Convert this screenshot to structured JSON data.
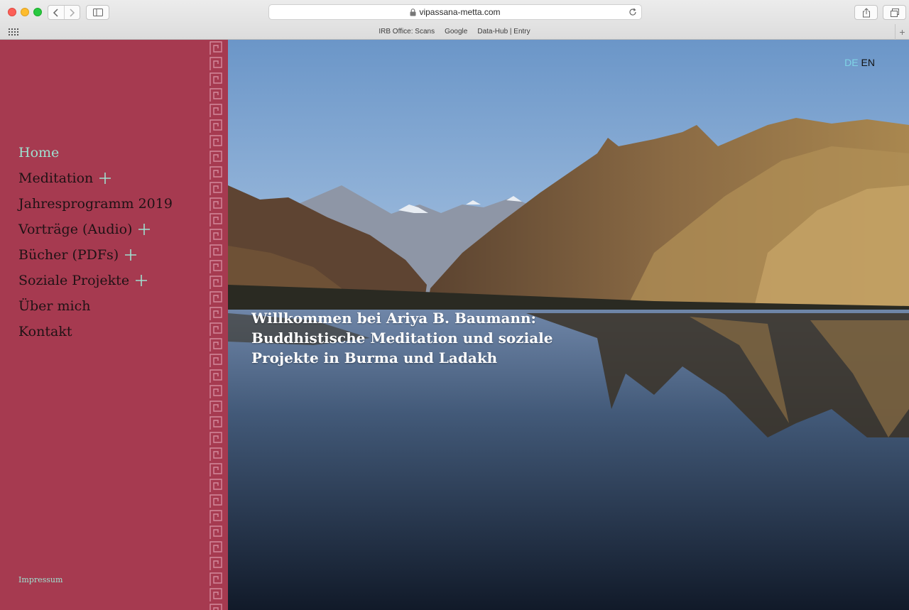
{
  "browser": {
    "url": "vipassana-metta.com",
    "bookmarks": [
      "IRB Office: Scans",
      "Google",
      "Data-Hub | Entry"
    ],
    "new_tab_symbol": "+"
  },
  "sidebar": {
    "nav_items": [
      {
        "label": "Home",
        "active": true,
        "expandable": false
      },
      {
        "label": "Meditation",
        "active": false,
        "expandable": true
      },
      {
        "label": "Jahresprogramm 2019",
        "active": false,
        "expandable": false
      },
      {
        "label": "Vorträge (Audio)",
        "active": false,
        "expandable": true
      },
      {
        "label": "Bücher (PDFs)",
        "active": false,
        "expandable": true
      },
      {
        "label": "Soziale Projekte",
        "active": false,
        "expandable": true
      },
      {
        "label": "Über mich",
        "active": false,
        "expandable": false
      },
      {
        "label": "Kontakt",
        "active": false,
        "expandable": false
      }
    ],
    "footer_link": "Impressum"
  },
  "hero": {
    "languages": {
      "de": "DE",
      "en": "EN"
    },
    "headline_lines": [
      "Willkommen bei Ariya B. Baumann:",
      "Buddhistische Meditation und soziale",
      "Projekte in Burma und Ladakh"
    ]
  },
  "colors": {
    "sidebar": "#a63a50",
    "accent": "#9ee0d0",
    "lang_active": "#7fd4e6"
  }
}
